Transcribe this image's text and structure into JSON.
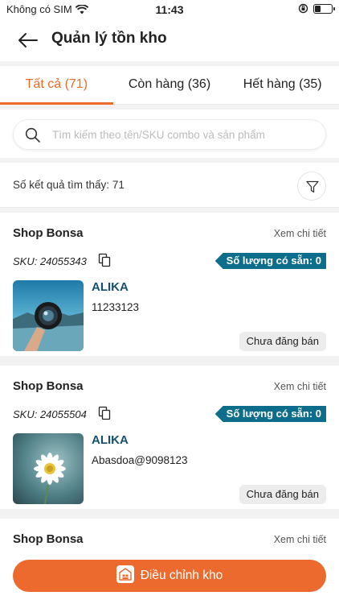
{
  "status_bar": {
    "carrier": "Không có SIM",
    "time": "11:43",
    "battery_level": 0.35
  },
  "header": {
    "title": "Quản lý tồn kho",
    "back_icon": "arrow-left-icon"
  },
  "tabs": [
    {
      "label": "Tất cả (71)",
      "active": true
    },
    {
      "label": "Còn hàng (36)",
      "active": false
    },
    {
      "label": "Hết hàng (35)",
      "active": false
    }
  ],
  "search": {
    "placeholder": "Tìm kiếm theo tên/SKU combo và sản phẩm",
    "value": ""
  },
  "results": {
    "label": "Số kết quả tìm thấy: 71"
  },
  "cards": [
    {
      "shop": "Shop Bonsa",
      "detail_label": "Xem chi tiết",
      "sku": "SKU: 24055343",
      "stock_label": "Số lượng có sẵn: 0",
      "product_name": "ALIKA",
      "product_code": "11233123",
      "status_label": "Chưa đăng bán"
    },
    {
      "shop": "Shop Bonsa",
      "detail_label": "Xem chi tiết",
      "sku": "SKU: 24055504",
      "stock_label": "Số lượng có sẵn: 0",
      "product_name": "ALIKA",
      "product_code": "Abasdoa@9098123",
      "status_label": "Chưa đăng bán"
    },
    {
      "shop": "Shop Bonsa",
      "detail_label": "Xem chi tiết"
    }
  ],
  "bottom": {
    "cta_label": "Điều chỉnh kho"
  },
  "colors": {
    "accent": "#ec6a2e",
    "tag": "#0d6e8c",
    "product_name": "#14506e"
  }
}
